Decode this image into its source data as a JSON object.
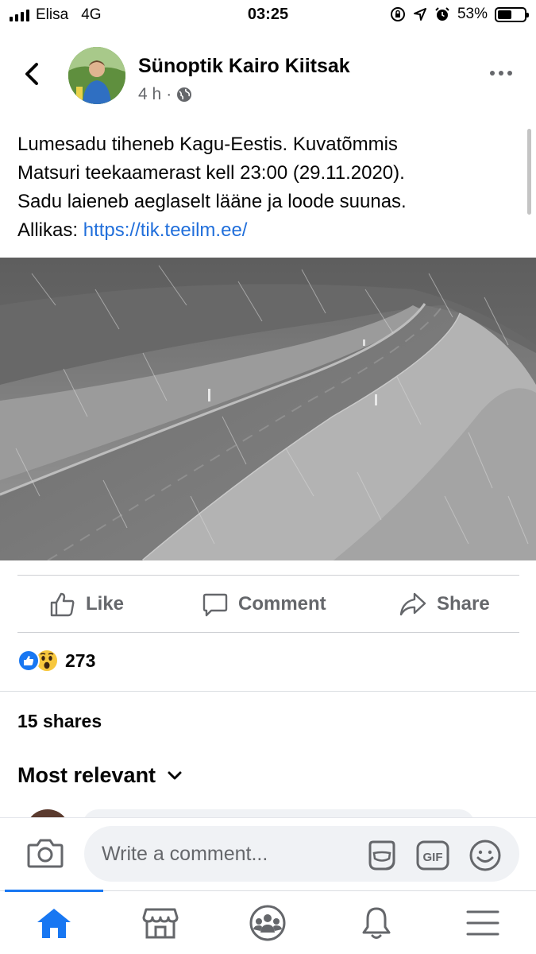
{
  "status_bar": {
    "carrier": "Elisa",
    "network": "4G",
    "time": "03:25",
    "battery_percent": "53%",
    "battery_level": 0.53
  },
  "post": {
    "author_name": "Sünoptik Kairo Kiitsak",
    "time_ago": "4 h",
    "meta_separator": "·",
    "audience_icon": "globe-icon",
    "text_lines": [
      "Lumesadu tiheneb Kagu-Eestis. Kuvatõmmis",
      "Matsuri teekaamerast kell 23:00 (29.11.2020).",
      "Sadu laieneb aeglaselt lääne ja loode suunas."
    ],
    "source_label": "Allikas:",
    "source_link": "https://tik.teeilm.ee/"
  },
  "actions": {
    "like": "Like",
    "comment": "Comment",
    "share": "Share"
  },
  "reactions": {
    "count": "273",
    "types": [
      "like",
      "wow"
    ]
  },
  "shares_text": "15 shares",
  "sort_label": "Most relevant",
  "composer": {
    "placeholder": "Write a comment..."
  },
  "nav": {
    "items": [
      "home-icon",
      "marketplace-icon",
      "groups-icon",
      "notifications-icon",
      "menu-icon"
    ],
    "active": "home-icon"
  },
  "colors": {
    "link": "#216fdb",
    "active": "#1877f2",
    "muted": "#65676b"
  }
}
